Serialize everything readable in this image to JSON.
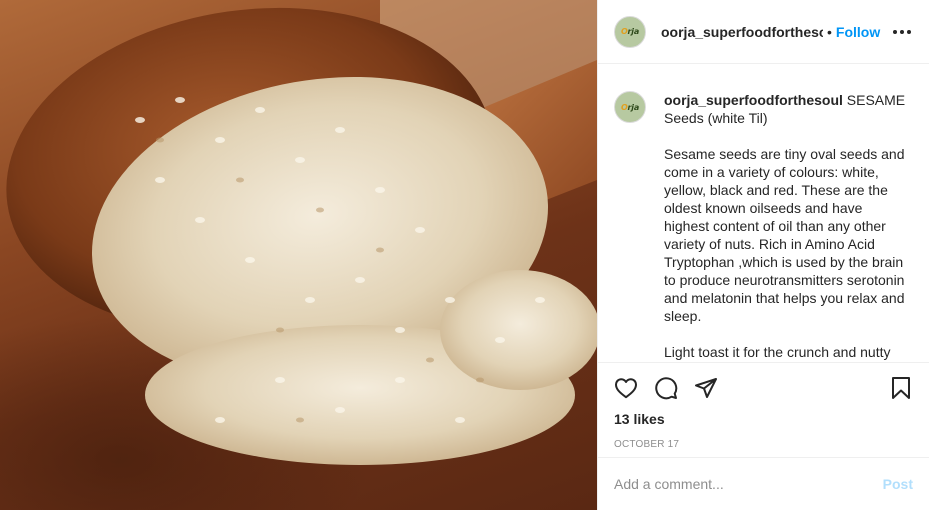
{
  "post": {
    "image_alt": "Wooden spoon full of white sesame seeds",
    "header": {
      "username": "oorja_superfoodforthesoul",
      "separator": "•",
      "follow_label": "Follow",
      "avatar_text": "Orja"
    },
    "caption": {
      "username": "oorja_superfoodforthesoul",
      "title": " SESAME Seeds (white Til)",
      "paragraph1": "Sesame seeds are tiny oval seeds and come in a variety of colours: white, yellow, black and red. These are the oldest known oilseeds and have highest content of oil than any other variety of nuts. Rich in Amino Acid Tryptophan ,which is used by the brain to produce neurotransmitters serotonin and melatonin that helps you relax and sleep.",
      "paragraph2": "Light toast it for the crunch and nutty"
    },
    "actions": {
      "icons": [
        "heart-icon",
        "comment-icon",
        "share-icon",
        "bookmark-icon"
      ],
      "likes": "13 likes",
      "date": "OCTOBER 17"
    },
    "comment": {
      "placeholder": "Add a comment...",
      "post_label": "Post"
    }
  },
  "colors": {
    "follow": "#0095f6",
    "post_disabled": "#b2dffc",
    "muted": "#8e8e8e",
    "text": "#262626",
    "divider": "#efefef"
  }
}
